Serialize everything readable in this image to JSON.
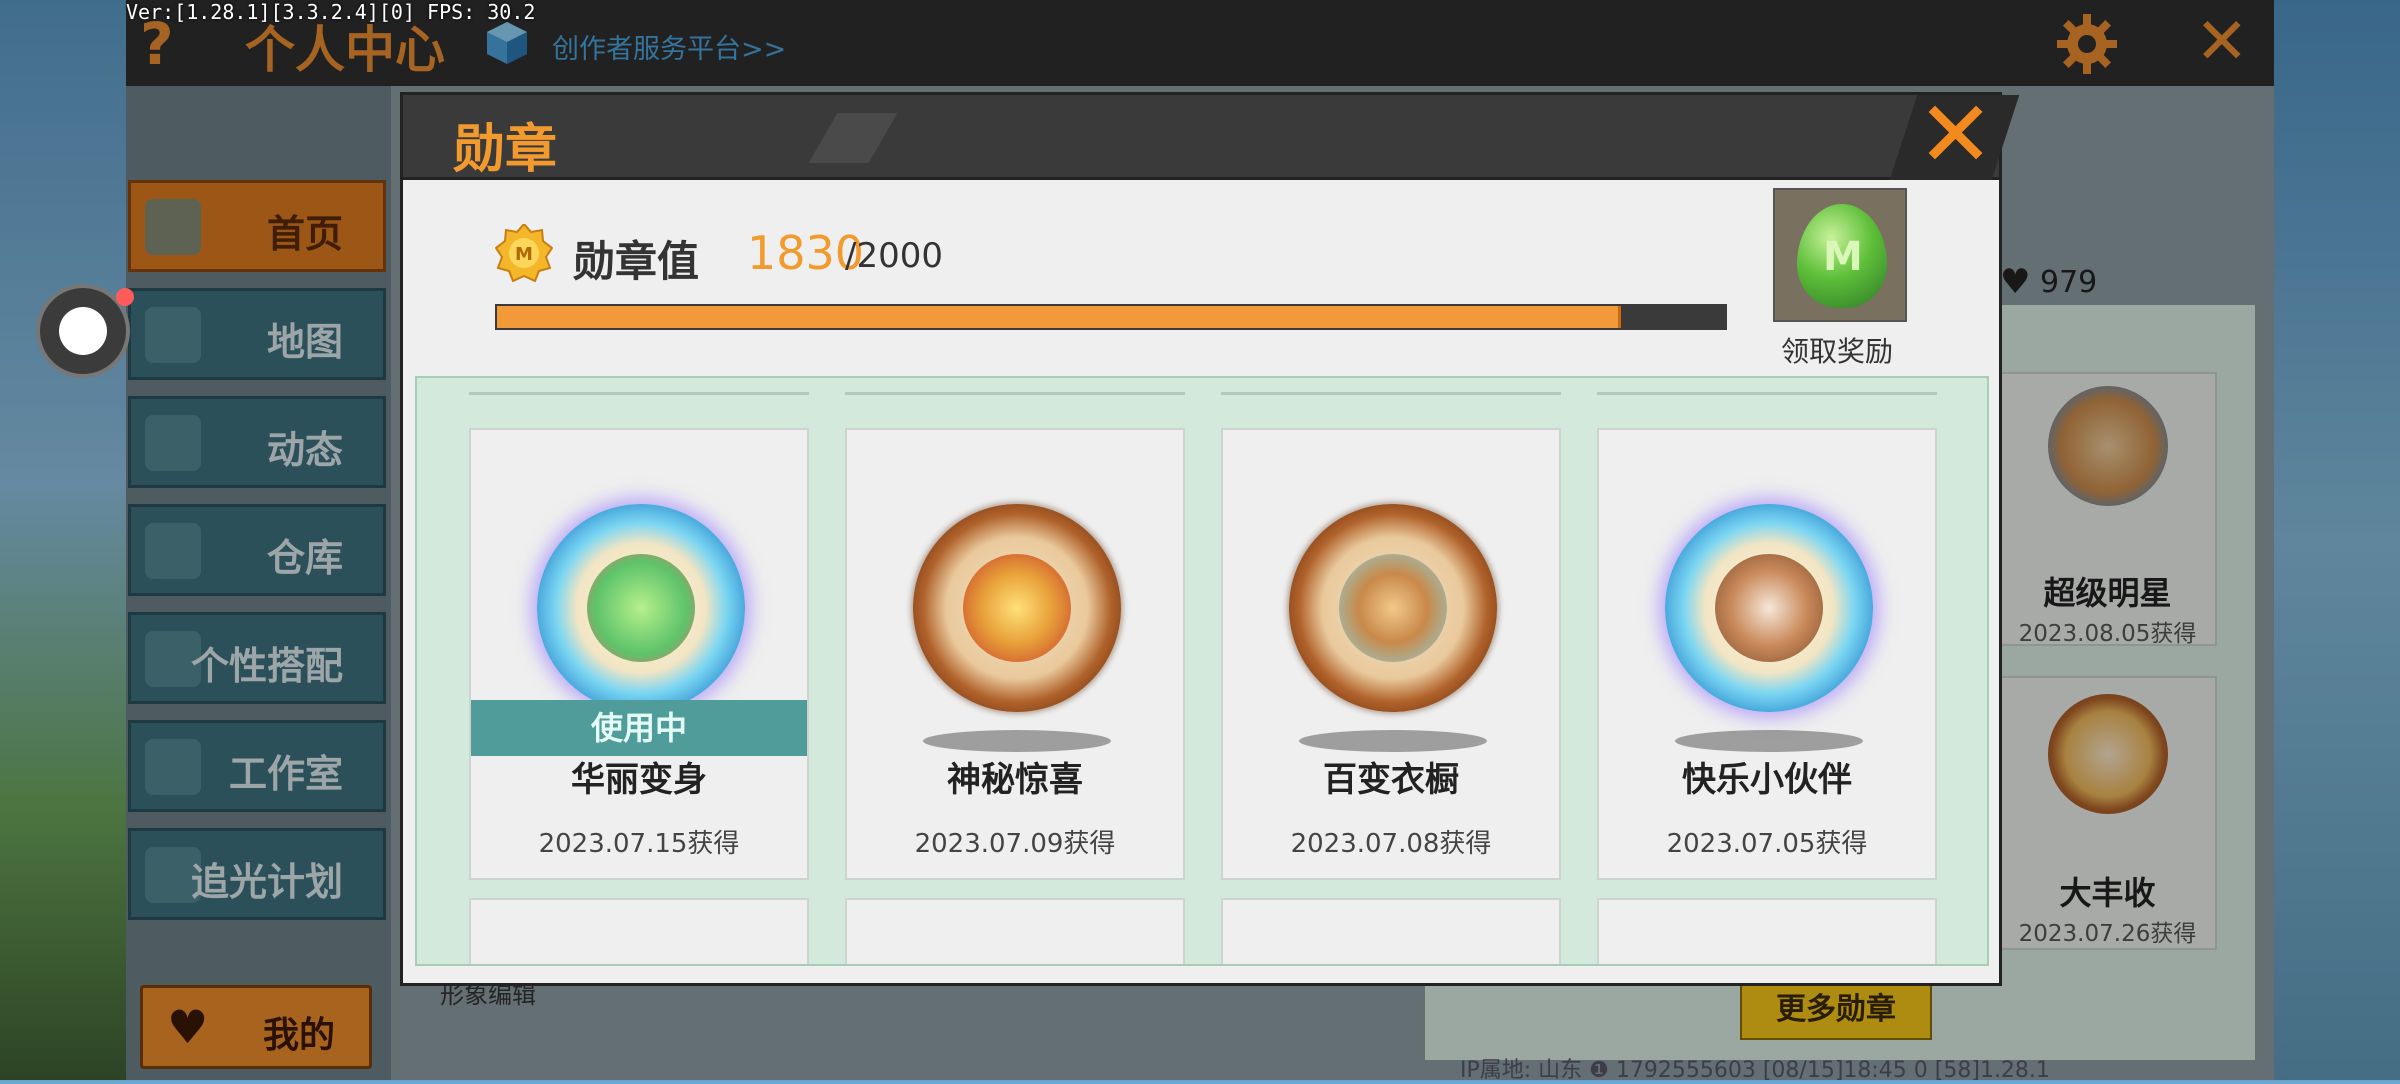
{
  "debug_info": "Ver:[1.28.1][3.3.2.4][0] FPS: 30.2",
  "topbar": {
    "help_icon": "?",
    "title": "个人中心",
    "creator_link": "创作者服务平台>>",
    "close_icon": "✕"
  },
  "sidebar": {
    "items": [
      {
        "label": "首页",
        "icon": "home-icon",
        "active": true
      },
      {
        "label": "地图",
        "icon": "map-icon",
        "active": false
      },
      {
        "label": "动态",
        "icon": "bell-icon",
        "active": false
      },
      {
        "label": "仓库",
        "icon": "warehouse-icon",
        "active": false
      },
      {
        "label": "个性搭配",
        "icon": "outfit-icon",
        "active": false
      },
      {
        "label": "工作室",
        "icon": "studio-icon",
        "active": false
      },
      {
        "label": "追光计划",
        "icon": "light-plan-icon",
        "active": false
      }
    ],
    "mine_button": "我的",
    "mine_icon": "♥"
  },
  "background_panel": {
    "count": "979",
    "count_icon": "♥",
    "shape_edit": "形象编辑",
    "medals": [
      {
        "name": "超级明星",
        "date": "2023.08.05获得"
      },
      {
        "name": "大丰收",
        "date": "2023.07.26获得"
      }
    ],
    "more_button": "更多勋章",
    "bottom_info": "IP属地: 山东 ❶   1792555603   [08/15]18:45 0   [58]1.28.1"
  },
  "dialog": {
    "title": "勋章",
    "close_icon": "✕",
    "medal_value_label": "勋章值",
    "medal_value": "1830",
    "medal_max": "/2000",
    "progress": 0.915,
    "reward_icon_letter": "M",
    "reward_label": "领取奖励",
    "in_use_label": "使用中",
    "medals": [
      {
        "name": "华丽变身",
        "date": "2023.07.15获得",
        "style": "crystal",
        "in_use": true
      },
      {
        "name": "神秘惊喜",
        "date": "2023.07.09获得",
        "style": "wood",
        "in_use": false
      },
      {
        "name": "百变衣橱",
        "date": "2023.07.08获得",
        "style": "wood",
        "in_use": false
      },
      {
        "name": "快乐小伙伴",
        "date": "2023.07.05获得",
        "style": "crystal",
        "in_use": false
      }
    ]
  },
  "colors": {
    "accent_orange": "#f29a2e",
    "sidebar_active": "#d9791f",
    "in_use_teal": "#4f9c9a",
    "grid_green": "#d3e9db"
  }
}
